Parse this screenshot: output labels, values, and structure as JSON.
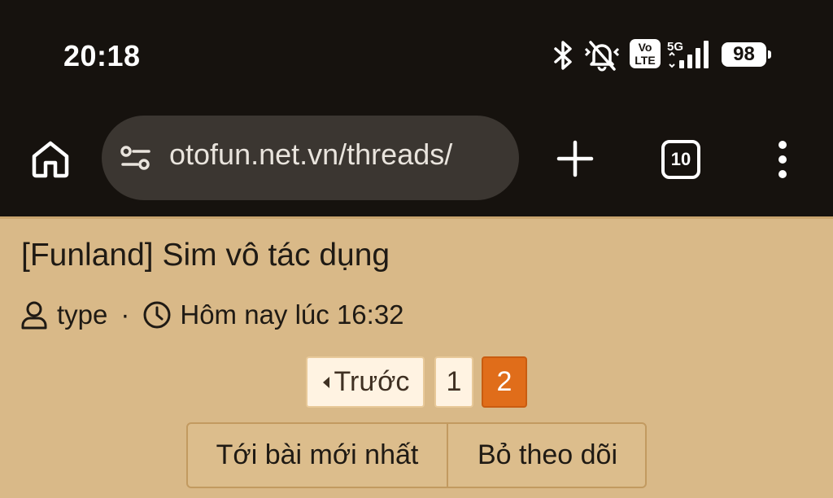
{
  "status_bar": {
    "time": "20:18",
    "icons": [
      "bluetooth-icon",
      "silent-mode-icon",
      "volte-icon",
      "5g-signal-icon"
    ],
    "volte_top": "Vo",
    "volte_bottom": "LTE",
    "network": "5G",
    "battery": "98"
  },
  "browser": {
    "url": "otofun.net.vn/threads/",
    "tab_count": "10"
  },
  "thread": {
    "title": "[Funland] Sim vô tác dụng",
    "author": "type",
    "separator": "·",
    "time": "Hôm nay lúc 16:32"
  },
  "pagination": {
    "prev_label": "Trước",
    "pages": [
      "1",
      "2"
    ],
    "current_page": "2"
  },
  "actions": {
    "latest_label": "Tới bài mới nhất",
    "unfollow_label": "Bỏ theo dõi"
  },
  "colors": {
    "page_bg": "#d9b988",
    "chrome_bg": "#16120e",
    "current_page": "#e06d1a"
  }
}
